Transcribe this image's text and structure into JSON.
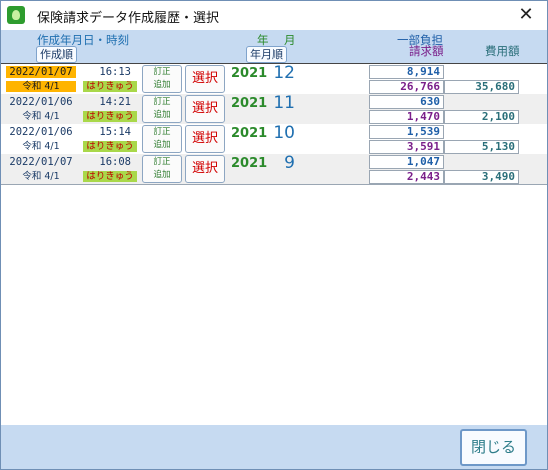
{
  "window": {
    "title": "保険請求データ作成履歴・選択",
    "close_symbol": "✕"
  },
  "header": {
    "created_label": "作成年月日・時刻",
    "created_sort_button": "作成順",
    "year_label": "年",
    "month_label": "月",
    "ym_sort_button": "年月順",
    "copay_label": "一部負担",
    "claim_label": "請求額",
    "cost_label": "費用額"
  },
  "rows": [
    {
      "date": "2022/01/07",
      "era": "令和 4/1",
      "time": "16:13",
      "tag": "はりきゅう",
      "fix_label": "訂正",
      "add_label": "追加",
      "select_label": "選択",
      "year": "2021",
      "month": "12",
      "copay": "8,914",
      "claim": "26,766",
      "cost": "35,680",
      "highlighted": true
    },
    {
      "date": "2022/01/06",
      "era": "令和 4/1",
      "time": "14:21",
      "tag": "はりきゅう",
      "fix_label": "訂正",
      "add_label": "追加",
      "select_label": "選択",
      "year": "2021",
      "month": "11",
      "copay": "630",
      "claim": "1,470",
      "cost": "2,100",
      "highlighted": false
    },
    {
      "date": "2022/01/06",
      "era": "令和 4/1",
      "time": "15:14",
      "tag": "はりきゅう",
      "fix_label": "訂正",
      "add_label": "追加",
      "select_label": "選択",
      "year": "2021",
      "month": "10",
      "copay": "1,539",
      "claim": "3,591",
      "cost": "5,130",
      "highlighted": false
    },
    {
      "date": "2022/01/07",
      "era": "令和 4/1",
      "time": "16:08",
      "tag": "はりきゅう",
      "fix_label": "訂正",
      "add_label": "追加",
      "select_label": "選択",
      "year": "2021",
      "month": "9",
      "copay": "1,047",
      "claim": "2,443",
      "cost": "3,490",
      "highlighted": false
    }
  ],
  "footer": {
    "close_button": "閉じる"
  },
  "colors": {
    "header_bg": "#c6daf1",
    "highlight": "#ffb400",
    "tag_bg": "#a9d84a",
    "select_text": "#d10000"
  }
}
